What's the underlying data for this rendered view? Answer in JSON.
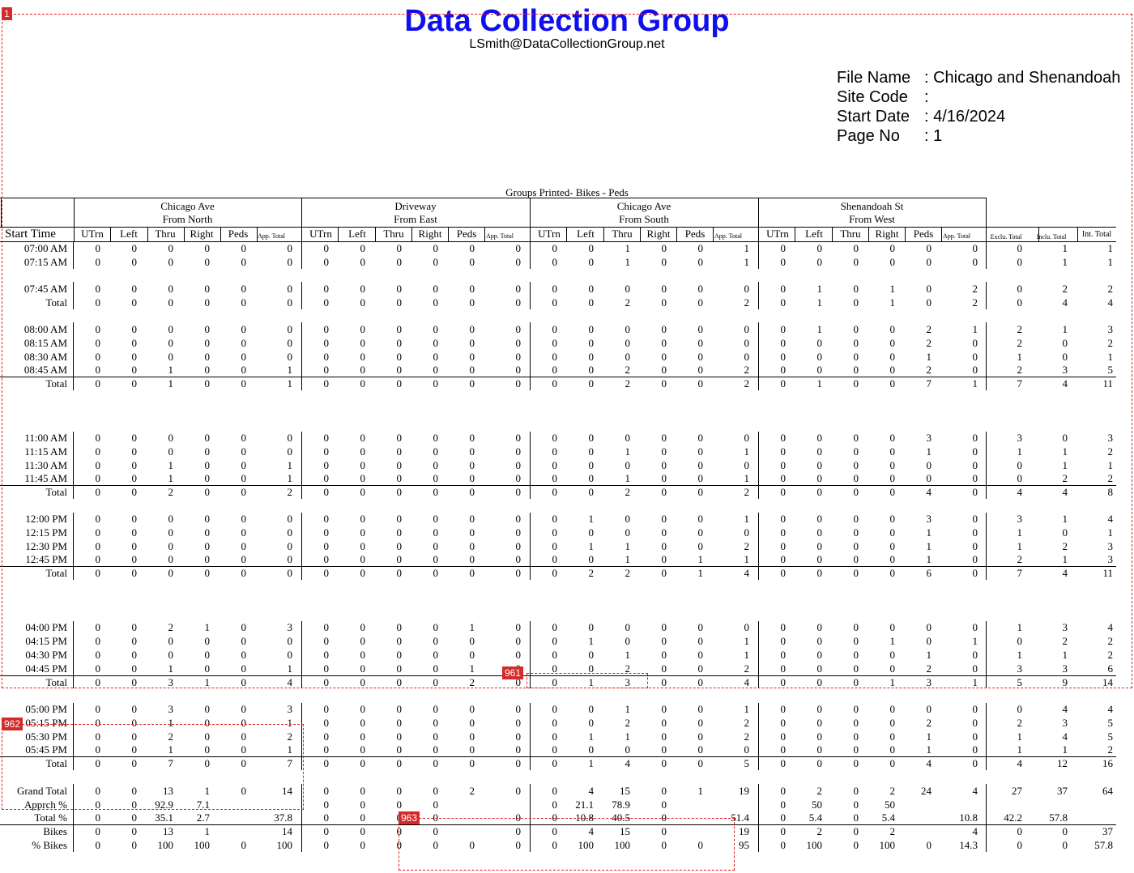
{
  "header": {
    "title": "Data Collection Group",
    "email": "LSmith@DataCollectionGroup.net"
  },
  "meta": {
    "rows": [
      {
        "key": "File Name",
        "value": ": Chicago and Shenandoah"
      },
      {
        "key": "Site Code",
        "value": ":"
      },
      {
        "key": "Start Date",
        "value": ": 4/16/2024"
      },
      {
        "key": "Page No",
        "value": ": 1"
      }
    ]
  },
  "groups_title": "Groups Printed- Bikes - Peds",
  "approaches": [
    {
      "name": "Chicago Ave",
      "dir": "From North"
    },
    {
      "name": "Driveway",
      "dir": "From East"
    },
    {
      "name": "Chicago Ave",
      "dir": "From South"
    },
    {
      "name": "Shenandoah St",
      "dir": "From West"
    }
  ],
  "start_time_label": "Start Time",
  "col_headers": [
    "UTrn",
    "Left",
    "Thru",
    "Right",
    "Peds",
    "App. Total"
  ],
  "total_headers": [
    "Exclu. Total",
    "Inclu. Total",
    "Int. Total"
  ],
  "rows": [
    {
      "label": "07:00 AM",
      "cells": [
        "0",
        "0",
        "0",
        "0",
        "0",
        "0",
        "0",
        "0",
        "0",
        "0",
        "0",
        "0",
        "0",
        "0",
        "1",
        "0",
        "0",
        "1",
        "0",
        "0",
        "0",
        "0",
        "0",
        "0",
        "0",
        "1",
        "1"
      ]
    },
    {
      "label": "07:15 AM",
      "cells": [
        "0",
        "0",
        "0",
        "0",
        "0",
        "0",
        "0",
        "0",
        "0",
        "0",
        "0",
        "0",
        "0",
        "0",
        "1",
        "0",
        "0",
        "1",
        "0",
        "0",
        "0",
        "0",
        "0",
        "0",
        "0",
        "1",
        "1"
      ]
    },
    {
      "label": "07:45 AM",
      "cells": [
        "0",
        "0",
        "0",
        "0",
        "0",
        "0",
        "0",
        "0",
        "0",
        "0",
        "0",
        "0",
        "0",
        "0",
        "0",
        "0",
        "0",
        "0",
        "0",
        "1",
        "0",
        "1",
        "0",
        "2",
        "0",
        "2",
        "2"
      ]
    },
    {
      "label": "Total",
      "cells": [
        "0",
        "0",
        "0",
        "0",
        "0",
        "0",
        "0",
        "0",
        "0",
        "0",
        "0",
        "0",
        "0",
        "0",
        "2",
        "0",
        "0",
        "2",
        "0",
        "1",
        "0",
        "1",
        "0",
        "2",
        "0",
        "4",
        "4"
      ]
    },
    {
      "label": "08:00 AM",
      "cells": [
        "0",
        "0",
        "0",
        "0",
        "0",
        "0",
        "0",
        "0",
        "0",
        "0",
        "0",
        "0",
        "0",
        "0",
        "0",
        "0",
        "0",
        "0",
        "0",
        "1",
        "0",
        "0",
        "2",
        "1",
        "2",
        "1",
        "3"
      ]
    },
    {
      "label": "08:15 AM",
      "cells": [
        "0",
        "0",
        "0",
        "0",
        "0",
        "0",
        "0",
        "0",
        "0",
        "0",
        "0",
        "0",
        "0",
        "0",
        "0",
        "0",
        "0",
        "0",
        "0",
        "0",
        "0",
        "0",
        "2",
        "0",
        "2",
        "0",
        "2"
      ]
    },
    {
      "label": "08:30 AM",
      "cells": [
        "0",
        "0",
        "0",
        "0",
        "0",
        "0",
        "0",
        "0",
        "0",
        "0",
        "0",
        "0",
        "0",
        "0",
        "0",
        "0",
        "0",
        "0",
        "0",
        "0",
        "0",
        "0",
        "1",
        "0",
        "1",
        "0",
        "1"
      ]
    },
    {
      "label": "08:45 AM",
      "cells": [
        "0",
        "0",
        "1",
        "0",
        "0",
        "1",
        "0",
        "0",
        "0",
        "0",
        "0",
        "0",
        "0",
        "0",
        "2",
        "0",
        "0",
        "2",
        "0",
        "0",
        "0",
        "0",
        "2",
        "0",
        "2",
        "3",
        "5"
      ]
    },
    {
      "label": "Total",
      "cells": [
        "0",
        "0",
        "1",
        "0",
        "0",
        "1",
        "0",
        "0",
        "0",
        "0",
        "0",
        "0",
        "0",
        "0",
        "2",
        "0",
        "0",
        "2",
        "0",
        "1",
        "0",
        "0",
        "7",
        "1",
        "7",
        "4",
        "11"
      ]
    },
    {
      "label": "11:00 AM",
      "cells": [
        "0",
        "0",
        "0",
        "0",
        "0",
        "0",
        "0",
        "0",
        "0",
        "0",
        "0",
        "0",
        "0",
        "0",
        "0",
        "0",
        "0",
        "0",
        "0",
        "0",
        "0",
        "0",
        "3",
        "0",
        "3",
        "0",
        "3"
      ]
    },
    {
      "label": "11:15 AM",
      "cells": [
        "0",
        "0",
        "0",
        "0",
        "0",
        "0",
        "0",
        "0",
        "0",
        "0",
        "0",
        "0",
        "0",
        "0",
        "1",
        "0",
        "0",
        "1",
        "0",
        "0",
        "0",
        "0",
        "1",
        "0",
        "1",
        "1",
        "2"
      ]
    },
    {
      "label": "11:30 AM",
      "cells": [
        "0",
        "0",
        "1",
        "0",
        "0",
        "1",
        "0",
        "0",
        "0",
        "0",
        "0",
        "0",
        "0",
        "0",
        "0",
        "0",
        "0",
        "0",
        "0",
        "0",
        "0",
        "0",
        "0",
        "0",
        "0",
        "1",
        "1"
      ]
    },
    {
      "label": "11:45 AM",
      "cells": [
        "0",
        "0",
        "1",
        "0",
        "0",
        "1",
        "0",
        "0",
        "0",
        "0",
        "0",
        "0",
        "0",
        "0",
        "1",
        "0",
        "0",
        "1",
        "0",
        "0",
        "0",
        "0",
        "0",
        "0",
        "0",
        "2",
        "2"
      ]
    },
    {
      "label": "Total",
      "cells": [
        "0",
        "0",
        "2",
        "0",
        "0",
        "2",
        "0",
        "0",
        "0",
        "0",
        "0",
        "0",
        "0",
        "0",
        "2",
        "0",
        "0",
        "2",
        "0",
        "0",
        "0",
        "0",
        "4",
        "0",
        "4",
        "4",
        "8"
      ]
    },
    {
      "label": "12:00 PM",
      "cells": [
        "0",
        "0",
        "0",
        "0",
        "0",
        "0",
        "0",
        "0",
        "0",
        "0",
        "0",
        "0",
        "0",
        "1",
        "0",
        "0",
        "0",
        "1",
        "0",
        "0",
        "0",
        "0",
        "3",
        "0",
        "3",
        "1",
        "4"
      ]
    },
    {
      "label": "12:15 PM",
      "cells": [
        "0",
        "0",
        "0",
        "0",
        "0",
        "0",
        "0",
        "0",
        "0",
        "0",
        "0",
        "0",
        "0",
        "0",
        "0",
        "0",
        "0",
        "0",
        "0",
        "0",
        "0",
        "0",
        "1",
        "0",
        "1",
        "0",
        "1"
      ]
    },
    {
      "label": "12:30 PM",
      "cells": [
        "0",
        "0",
        "0",
        "0",
        "0",
        "0",
        "0",
        "0",
        "0",
        "0",
        "0",
        "0",
        "0",
        "1",
        "1",
        "0",
        "0",
        "2",
        "0",
        "0",
        "0",
        "0",
        "1",
        "0",
        "1",
        "2",
        "3"
      ]
    },
    {
      "label": "12:45 PM",
      "cells": [
        "0",
        "0",
        "0",
        "0",
        "0",
        "0",
        "0",
        "0",
        "0",
        "0",
        "0",
        "0",
        "0",
        "0",
        "1",
        "0",
        "1",
        "1",
        "0",
        "0",
        "0",
        "0",
        "1",
        "0",
        "2",
        "1",
        "3"
      ]
    },
    {
      "label": "Total",
      "cells": [
        "0",
        "0",
        "0",
        "0",
        "0",
        "0",
        "0",
        "0",
        "0",
        "0",
        "0",
        "0",
        "0",
        "2",
        "2",
        "0",
        "1",
        "4",
        "0",
        "0",
        "0",
        "0",
        "6",
        "0",
        "7",
        "4",
        "11"
      ]
    },
    {
      "label": "04:00 PM",
      "cells": [
        "0",
        "0",
        "2",
        "1",
        "0",
        "3",
        "0",
        "0",
        "0",
        "0",
        "1",
        "0",
        "0",
        "0",
        "0",
        "0",
        "0",
        "0",
        "0",
        "0",
        "0",
        "0",
        "0",
        "0",
        "1",
        "3",
        "4"
      ]
    },
    {
      "label": "04:15 PM",
      "cells": [
        "0",
        "0",
        "0",
        "0",
        "0",
        "0",
        "0",
        "0",
        "0",
        "0",
        "0",
        "0",
        "0",
        "1",
        "0",
        "0",
        "0",
        "1",
        "0",
        "0",
        "0",
        "1",
        "0",
        "1",
        "0",
        "2",
        "2"
      ]
    },
    {
      "label": "04:30 PM",
      "cells": [
        "0",
        "0",
        "0",
        "0",
        "0",
        "0",
        "0",
        "0",
        "0",
        "0",
        "0",
        "0",
        "0",
        "0",
        "1",
        "0",
        "0",
        "1",
        "0",
        "0",
        "0",
        "0",
        "1",
        "0",
        "1",
        "1",
        "2"
      ]
    },
    {
      "label": "04:45 PM",
      "cells": [
        "0",
        "0",
        "1",
        "0",
        "0",
        "1",
        "0",
        "0",
        "0",
        "0",
        "1",
        "0",
        "0",
        "0",
        "2",
        "0",
        "0",
        "2",
        "0",
        "0",
        "0",
        "0",
        "2",
        "0",
        "3",
        "3",
        "6"
      ]
    },
    {
      "label": "Total",
      "cells": [
        "0",
        "0",
        "3",
        "1",
        "0",
        "4",
        "0",
        "0",
        "0",
        "0",
        "2",
        "0",
        "0",
        "1",
        "3",
        "0",
        "0",
        "4",
        "0",
        "0",
        "0",
        "1",
        "3",
        "1",
        "5",
        "9",
        "14"
      ]
    },
    {
      "label": "05:00 PM",
      "cells": [
        "0",
        "0",
        "3",
        "0",
        "0",
        "3",
        "0",
        "0",
        "0",
        "0",
        "0",
        "0",
        "0",
        "0",
        "1",
        "0",
        "0",
        "1",
        "0",
        "0",
        "0",
        "0",
        "0",
        "0",
        "0",
        "4",
        "4"
      ]
    },
    {
      "label": "05:15 PM",
      "cells": [
        "0",
        "0",
        "1",
        "0",
        "0",
        "1",
        "0",
        "0",
        "0",
        "0",
        "0",
        "0",
        "0",
        "0",
        "2",
        "0",
        "0",
        "2",
        "0",
        "0",
        "0",
        "0",
        "2",
        "0",
        "2",
        "3",
        "5"
      ]
    },
    {
      "label": "05:30 PM",
      "cells": [
        "0",
        "0",
        "2",
        "0",
        "0",
        "2",
        "0",
        "0",
        "0",
        "0",
        "0",
        "0",
        "0",
        "1",
        "1",
        "0",
        "0",
        "2",
        "0",
        "0",
        "0",
        "0",
        "1",
        "0",
        "1",
        "4",
        "5"
      ]
    },
    {
      "label": "05:45 PM",
      "cells": [
        "0",
        "0",
        "1",
        "0",
        "0",
        "1",
        "0",
        "0",
        "0",
        "0",
        "0",
        "0",
        "0",
        "0",
        "0",
        "0",
        "0",
        "0",
        "0",
        "0",
        "0",
        "0",
        "1",
        "0",
        "1",
        "1",
        "2"
      ]
    },
    {
      "label": "Total",
      "cells": [
        "0",
        "0",
        "7",
        "0",
        "0",
        "7",
        "0",
        "0",
        "0",
        "0",
        "0",
        "0",
        "0",
        "1",
        "4",
        "0",
        "0",
        "5",
        "0",
        "0",
        "0",
        "0",
        "4",
        "0",
        "4",
        "12",
        "16"
      ]
    },
    {
      "label": "Grand Total",
      "cells": [
        "0",
        "0",
        "13",
        "1",
        "0",
        "14",
        "0",
        "0",
        "0",
        "0",
        "2",
        "0",
        "0",
        "4",
        "15",
        "0",
        "1",
        "19",
        "0",
        "2",
        "0",
        "2",
        "24",
        "4",
        "27",
        "37",
        "64"
      ]
    },
    {
      "label": "Apprch %",
      "cells": [
        "0",
        "0",
        "92.9",
        "7.1",
        "",
        "",
        "0",
        "0",
        "0",
        "0",
        "",
        "",
        "0",
        "21.1",
        "78.9",
        "0",
        "",
        "",
        "0",
        "50",
        "0",
        "50",
        "",
        "",
        "",
        "",
        ""
      ]
    },
    {
      "label": "Total %",
      "cells": [
        "0",
        "0",
        "35.1",
        "2.7",
        "",
        "37.8",
        "0",
        "0",
        "0",
        "0",
        "",
        "0",
        "0",
        "10.8",
        "40.5",
        "0",
        "",
        "51.4",
        "0",
        "5.4",
        "0",
        "5.4",
        "",
        "10.8",
        "42.2",
        "57.8",
        ""
      ]
    },
    {
      "label": "Bikes",
      "cells": [
        "0",
        "0",
        "13",
        "1",
        "",
        "14",
        "0",
        "0",
        "0",
        "0",
        "",
        "0",
        "0",
        "4",
        "15",
        "0",
        "",
        "19",
        "0",
        "2",
        "0",
        "2",
        "",
        "4",
        "0",
        "0",
        "37"
      ]
    },
    {
      "label": "% Bikes",
      "cells": [
        "0",
        "0",
        "100",
        "100",
        "0",
        "100",
        "0",
        "0",
        "0",
        "0",
        "0",
        "0",
        "0",
        "100",
        "100",
        "0",
        "0",
        "95",
        "0",
        "100",
        "0",
        "100",
        "0",
        "14.3",
        "0",
        "0",
        "57.8"
      ]
    }
  ],
  "annotations": [
    {
      "label": "1"
    },
    {
      "label": "961"
    },
    {
      "label": "962"
    },
    {
      "label": "963"
    }
  ]
}
